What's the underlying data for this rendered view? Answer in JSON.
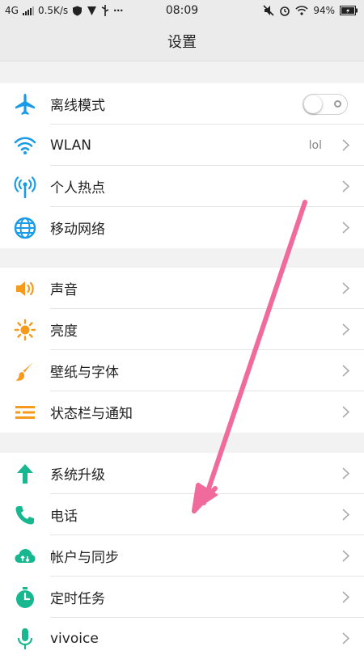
{
  "status_bar": {
    "network": "4G",
    "speed": "0.5K/s",
    "time": "08:09",
    "battery": "94%"
  },
  "header": {
    "title": "设置"
  },
  "groups": [
    {
      "items": [
        {
          "label": "离线模式",
          "icon": "airplane-icon",
          "control": "toggle",
          "toggle_on": false
        },
        {
          "label": "WLAN",
          "icon": "wifi-icon",
          "value": "lol"
        },
        {
          "label": "个人热点",
          "icon": "hotspot-icon"
        },
        {
          "label": "移动网络",
          "icon": "globe-icon"
        }
      ]
    },
    {
      "items": [
        {
          "label": "声音",
          "icon": "speaker-icon"
        },
        {
          "label": "亮度",
          "icon": "sun-icon"
        },
        {
          "label": "壁纸与字体",
          "icon": "paintbrush-icon"
        },
        {
          "label": "状态栏与通知",
          "icon": "list-icon"
        }
      ]
    },
    {
      "items": [
        {
          "label": "系统升级",
          "icon": "arrow-up-icon"
        },
        {
          "label": "电话",
          "icon": "phone-icon"
        },
        {
          "label": "帐户与同步",
          "icon": "cloud-sync-icon"
        },
        {
          "label": "定时任务",
          "icon": "timer-icon"
        },
        {
          "label": "vivoice",
          "icon": "microphone-icon"
        }
      ]
    }
  ],
  "colors": {
    "blue": "#1a9be8",
    "orange": "#f59a1b",
    "green": "#17b890",
    "annotation_arrow": "#f06a9b"
  }
}
